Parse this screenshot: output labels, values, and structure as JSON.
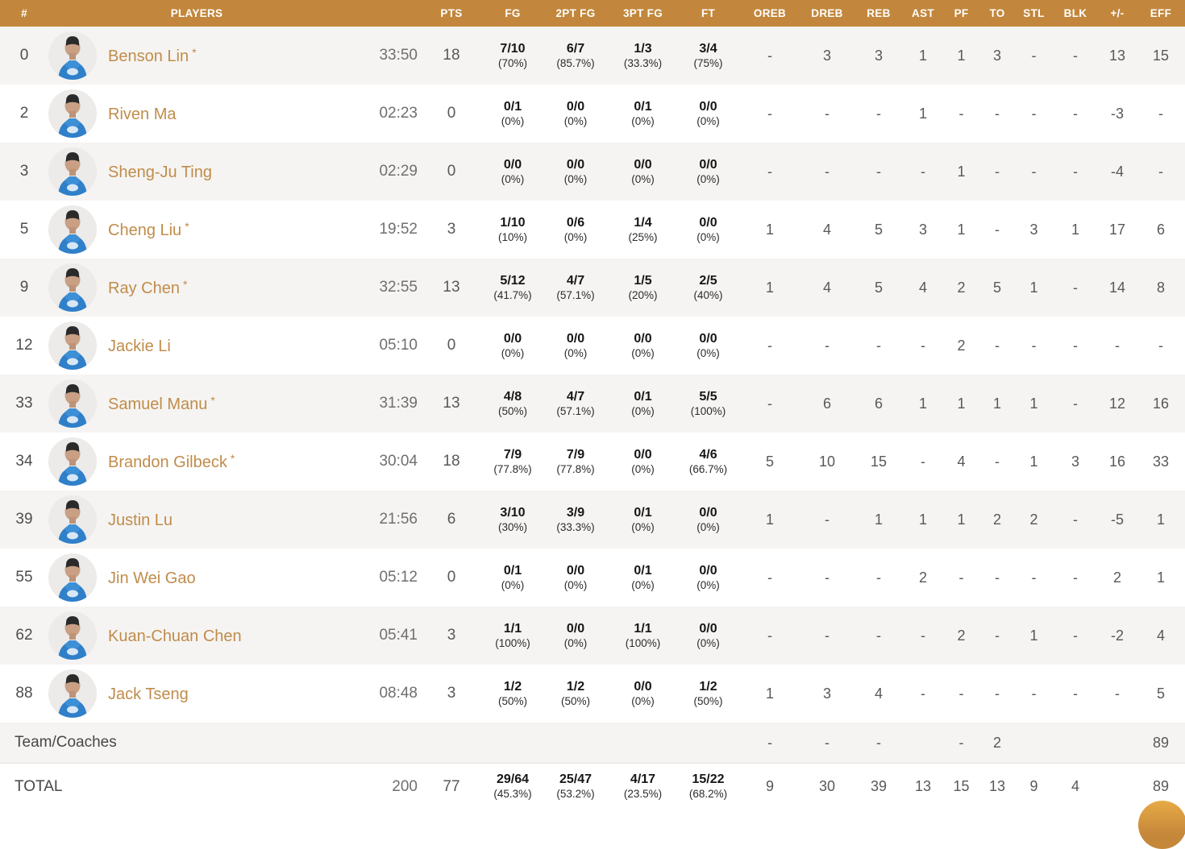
{
  "header": {
    "columns": [
      "#",
      "PLAYERS",
      "",
      "PTS",
      "FG",
      "2PT FG",
      "3PT FG",
      "FT",
      "OREB",
      "DREB",
      "REB",
      "AST",
      "PF",
      "TO",
      "STL",
      "BLK",
      "+/-",
      "EFF"
    ]
  },
  "players": [
    {
      "num": "0",
      "name": "Benson Lin",
      "star": "*",
      "min": "33:50",
      "pts": "18",
      "fg": [
        "7/10",
        "(70%)"
      ],
      "fg2": [
        "6/7",
        "(85.7%)"
      ],
      "fg3": [
        "1/3",
        "(33.3%)"
      ],
      "ft": [
        "3/4",
        "(75%)"
      ],
      "oreb": "-",
      "dreb": "3",
      "reb": "3",
      "ast": "1",
      "pf": "1",
      "to": "3",
      "stl": "-",
      "blk": "-",
      "pm": "13",
      "eff": "15"
    },
    {
      "num": "2",
      "name": "Riven Ma",
      "star": "",
      "min": "02:23",
      "pts": "0",
      "fg": [
        "0/1",
        "(0%)"
      ],
      "fg2": [
        "0/0",
        "(0%)"
      ],
      "fg3": [
        "0/1",
        "(0%)"
      ],
      "ft": [
        "0/0",
        "(0%)"
      ],
      "oreb": "-",
      "dreb": "-",
      "reb": "-",
      "ast": "1",
      "pf": "-",
      "to": "-",
      "stl": "-",
      "blk": "-",
      "pm": "-3",
      "eff": "-"
    },
    {
      "num": "3",
      "name": "Sheng-Ju Ting",
      "star": "",
      "min": "02:29",
      "pts": "0",
      "fg": [
        "0/0",
        "(0%)"
      ],
      "fg2": [
        "0/0",
        "(0%)"
      ],
      "fg3": [
        "0/0",
        "(0%)"
      ],
      "ft": [
        "0/0",
        "(0%)"
      ],
      "oreb": "-",
      "dreb": "-",
      "reb": "-",
      "ast": "-",
      "pf": "1",
      "to": "-",
      "stl": "-",
      "blk": "-",
      "pm": "-4",
      "eff": "-"
    },
    {
      "num": "5",
      "name": "Cheng Liu",
      "star": "*",
      "min": "19:52",
      "pts": "3",
      "fg": [
        "1/10",
        "(10%)"
      ],
      "fg2": [
        "0/6",
        "(0%)"
      ],
      "fg3": [
        "1/4",
        "(25%)"
      ],
      "ft": [
        "0/0",
        "(0%)"
      ],
      "oreb": "1",
      "dreb": "4",
      "reb": "5",
      "ast": "3",
      "pf": "1",
      "to": "-",
      "stl": "3",
      "blk": "1",
      "pm": "17",
      "eff": "6"
    },
    {
      "num": "9",
      "name": "Ray Chen",
      "star": "*",
      "min": "32:55",
      "pts": "13",
      "fg": [
        "5/12",
        "(41.7%)"
      ],
      "fg2": [
        "4/7",
        "(57.1%)"
      ],
      "fg3": [
        "1/5",
        "(20%)"
      ],
      "ft": [
        "2/5",
        "(40%)"
      ],
      "oreb": "1",
      "dreb": "4",
      "reb": "5",
      "ast": "4",
      "pf": "2",
      "to": "5",
      "stl": "1",
      "blk": "-",
      "pm": "14",
      "eff": "8"
    },
    {
      "num": "12",
      "name": "Jackie Li",
      "star": "",
      "min": "05:10",
      "pts": "0",
      "fg": [
        "0/0",
        "(0%)"
      ],
      "fg2": [
        "0/0",
        "(0%)"
      ],
      "fg3": [
        "0/0",
        "(0%)"
      ],
      "ft": [
        "0/0",
        "(0%)"
      ],
      "oreb": "-",
      "dreb": "-",
      "reb": "-",
      "ast": "-",
      "pf": "2",
      "to": "-",
      "stl": "-",
      "blk": "-",
      "pm": "-",
      "eff": "-"
    },
    {
      "num": "33",
      "name": "Samuel Manu",
      "star": "*",
      "min": "31:39",
      "pts": "13",
      "fg": [
        "4/8",
        "(50%)"
      ],
      "fg2": [
        "4/7",
        "(57.1%)"
      ],
      "fg3": [
        "0/1",
        "(0%)"
      ],
      "ft": [
        "5/5",
        "(100%)"
      ],
      "oreb": "-",
      "dreb": "6",
      "reb": "6",
      "ast": "1",
      "pf": "1",
      "to": "1",
      "stl": "1",
      "blk": "-",
      "pm": "12",
      "eff": "16"
    },
    {
      "num": "34",
      "name": "Brandon Gilbeck",
      "star": "*",
      "min": "30:04",
      "pts": "18",
      "fg": [
        "7/9",
        "(77.8%)"
      ],
      "fg2": [
        "7/9",
        "(77.8%)"
      ],
      "fg3": [
        "0/0",
        "(0%)"
      ],
      "ft": [
        "4/6",
        "(66.7%)"
      ],
      "oreb": "5",
      "dreb": "10",
      "reb": "15",
      "ast": "-",
      "pf": "4",
      "to": "-",
      "stl": "1",
      "blk": "3",
      "pm": "16",
      "eff": "33"
    },
    {
      "num": "39",
      "name": "Justin Lu",
      "star": "",
      "min": "21:56",
      "pts": "6",
      "fg": [
        "3/10",
        "(30%)"
      ],
      "fg2": [
        "3/9",
        "(33.3%)"
      ],
      "fg3": [
        "0/1",
        "(0%)"
      ],
      "ft": [
        "0/0",
        "(0%)"
      ],
      "oreb": "1",
      "dreb": "-",
      "reb": "1",
      "ast": "1",
      "pf": "1",
      "to": "2",
      "stl": "2",
      "blk": "-",
      "pm": "-5",
      "eff": "1"
    },
    {
      "num": "55",
      "name": "Jin Wei Gao",
      "star": "",
      "min": "05:12",
      "pts": "0",
      "fg": [
        "0/1",
        "(0%)"
      ],
      "fg2": [
        "0/0",
        "(0%)"
      ],
      "fg3": [
        "0/1",
        "(0%)"
      ],
      "ft": [
        "0/0",
        "(0%)"
      ],
      "oreb": "-",
      "dreb": "-",
      "reb": "-",
      "ast": "2",
      "pf": "-",
      "to": "-",
      "stl": "-",
      "blk": "-",
      "pm": "2",
      "eff": "1"
    },
    {
      "num": "62",
      "name": "Kuan-Chuan Chen",
      "star": "",
      "min": "05:41",
      "pts": "3",
      "fg": [
        "1/1",
        "(100%)"
      ],
      "fg2": [
        "0/0",
        "(0%)"
      ],
      "fg3": [
        "1/1",
        "(100%)"
      ],
      "ft": [
        "0/0",
        "(0%)"
      ],
      "oreb": "-",
      "dreb": "-",
      "reb": "-",
      "ast": "-",
      "pf": "2",
      "to": "-",
      "stl": "1",
      "blk": "-",
      "pm": "-2",
      "eff": "4"
    },
    {
      "num": "88",
      "name": "Jack Tseng",
      "star": "",
      "min": "08:48",
      "pts": "3",
      "fg": [
        "1/2",
        "(50%)"
      ],
      "fg2": [
        "1/2",
        "(50%)"
      ],
      "fg3": [
        "0/0",
        "(0%)"
      ],
      "ft": [
        "1/2",
        "(50%)"
      ],
      "oreb": "1",
      "dreb": "3",
      "reb": "4",
      "ast": "-",
      "pf": "-",
      "to": "-",
      "stl": "-",
      "blk": "-",
      "pm": "-",
      "eff": "5"
    }
  ],
  "team_row": {
    "label": "Team/Coaches",
    "oreb": "-",
    "dreb": "-",
    "reb": "-",
    "ast": "",
    "pf": "-",
    "to": "2",
    "stl": "",
    "blk": "",
    "pm": "",
    "eff": "89"
  },
  "total_row": {
    "label": "TOTAL",
    "min": "200",
    "pts": "77",
    "fg": [
      "29/64",
      "(45.3%)"
    ],
    "fg2": [
      "25/47",
      "(53.2%)"
    ],
    "fg3": [
      "4/17",
      "(23.5%)"
    ],
    "ft": [
      "15/22",
      "(68.2%)"
    ],
    "oreb": "9",
    "dreb": "30",
    "reb": "39",
    "ast": "13",
    "pf": "15",
    "to": "13",
    "stl": "9",
    "blk": "4",
    "pm": "",
    "eff": "89"
  },
  "colors": {
    "header_bg": "#C2873C",
    "player_name": "#C08C4B",
    "row_alt_bg": "#F5F4F2",
    "stat_text": "#585858",
    "fab_gold": "#D69A42",
    "jersey_blue": "#2F80C9"
  },
  "icons": {
    "avatar": "player-photo",
    "fab": "floating-action-button"
  }
}
